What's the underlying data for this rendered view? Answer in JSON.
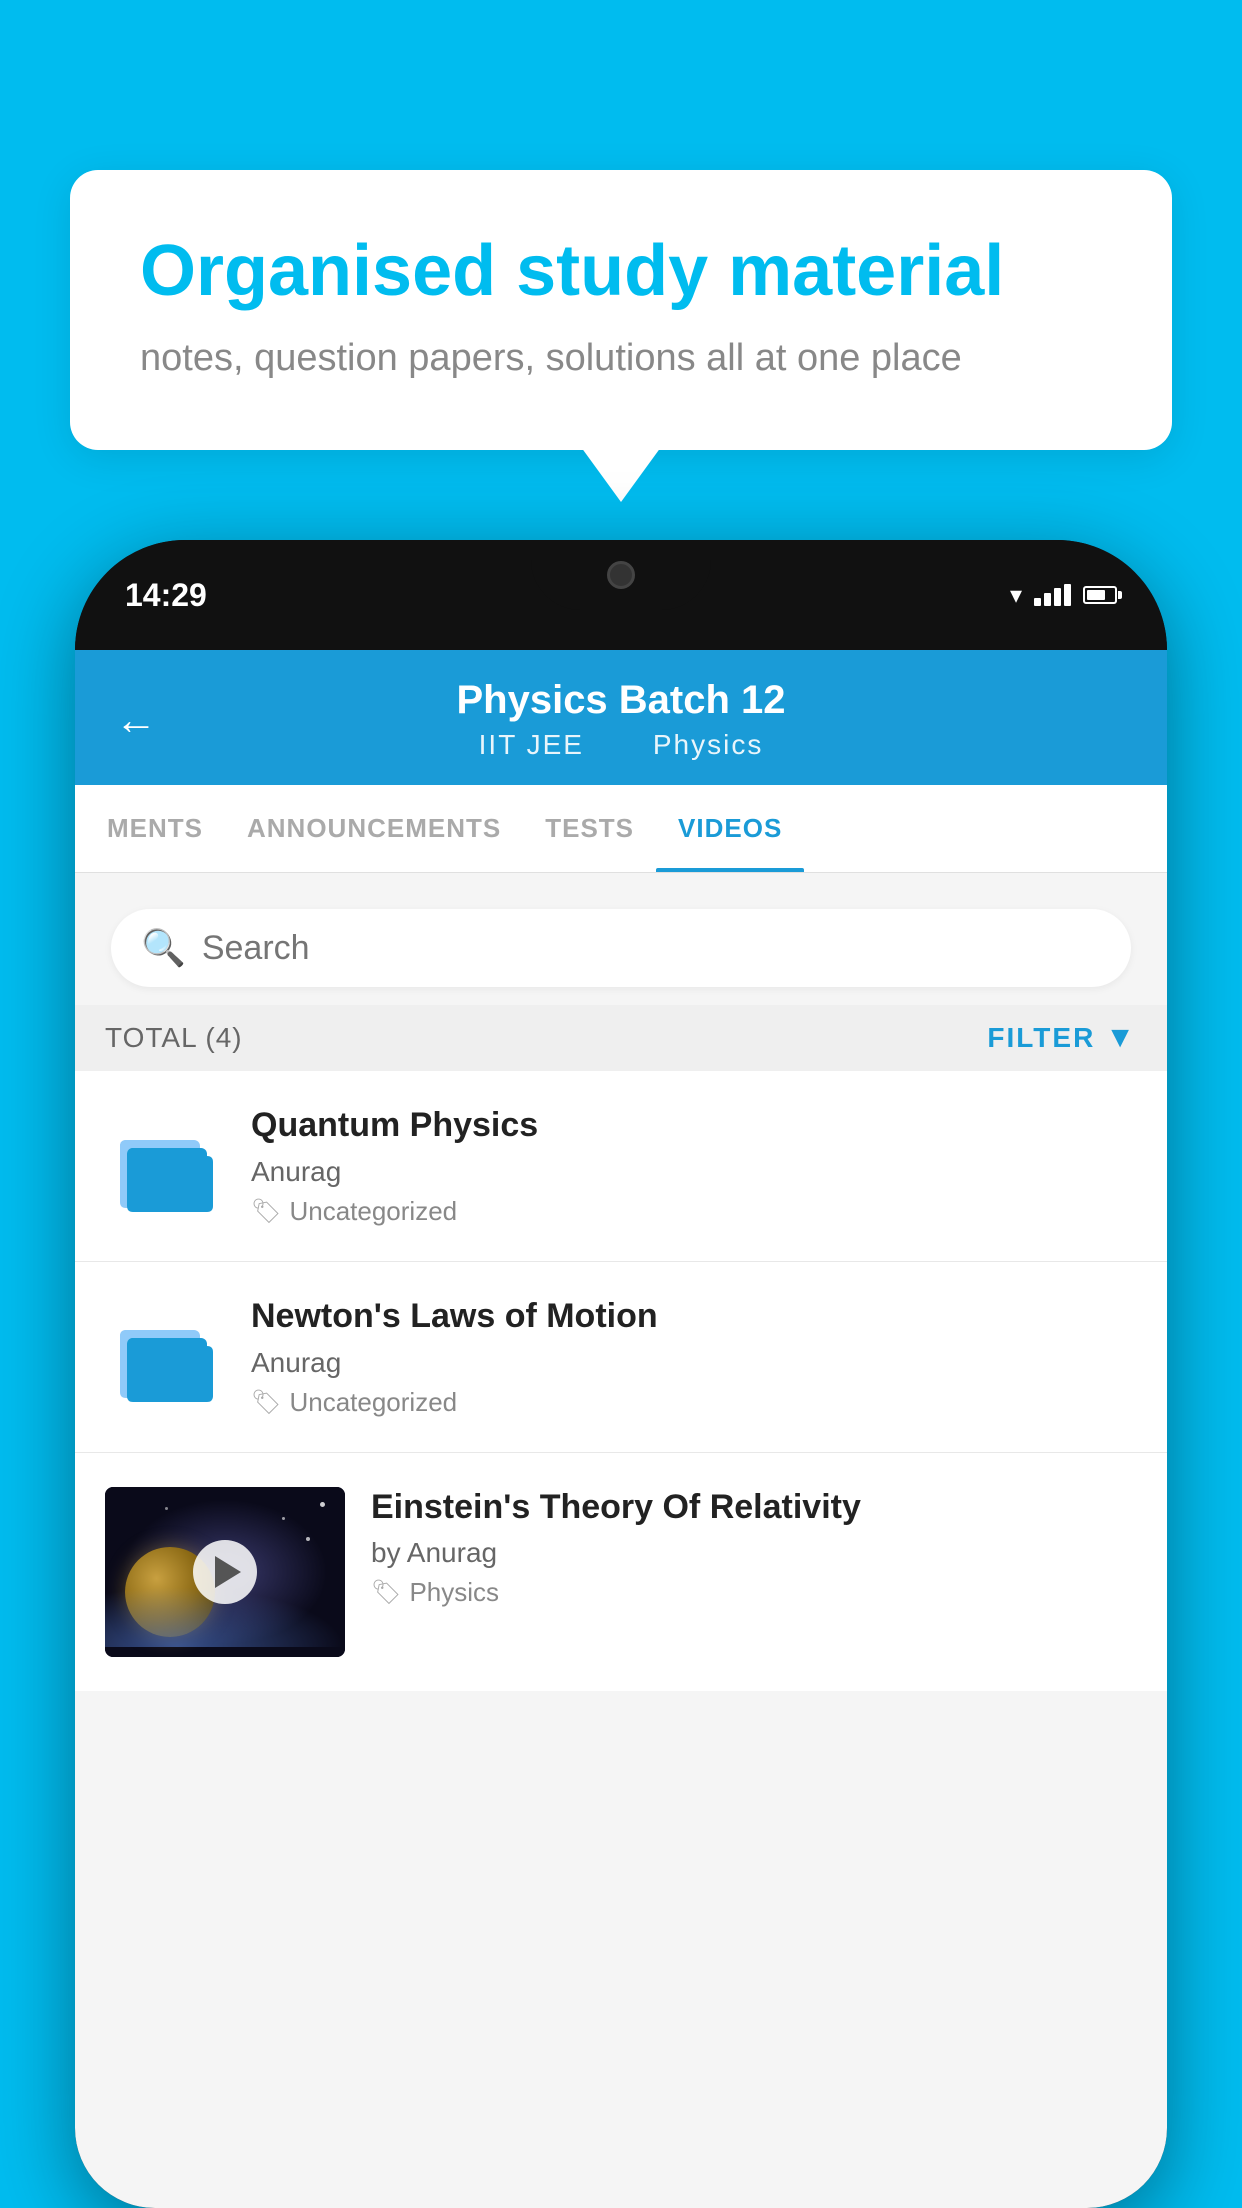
{
  "background": {
    "color": "#00BCEF"
  },
  "speech_bubble": {
    "title": "Organised study material",
    "subtitle": "notes, question papers, solutions all at one place"
  },
  "phone": {
    "status_bar": {
      "time": "14:29"
    },
    "header": {
      "title": "Physics Batch 12",
      "subtitle_part1": "IIT JEE",
      "subtitle_part2": "Physics"
    },
    "tabs": [
      {
        "label": "MENTS",
        "active": false
      },
      {
        "label": "ANNOUNCEMENTS",
        "active": false
      },
      {
        "label": "TESTS",
        "active": false
      },
      {
        "label": "VIDEOS",
        "active": true
      }
    ],
    "search": {
      "placeholder": "Search"
    },
    "filter_bar": {
      "total_label": "TOTAL (4)",
      "filter_label": "FILTER"
    },
    "videos": [
      {
        "id": 1,
        "title": "Quantum Physics",
        "author": "Anurag",
        "tag": "Uncategorized",
        "type": "folder"
      },
      {
        "id": 2,
        "title": "Newton's Laws of Motion",
        "author": "Anurag",
        "tag": "Uncategorized",
        "type": "folder"
      },
      {
        "id": 3,
        "title": "Einstein's Theory Of Relativity",
        "author": "by Anurag",
        "tag": "Physics",
        "type": "video"
      }
    ]
  }
}
